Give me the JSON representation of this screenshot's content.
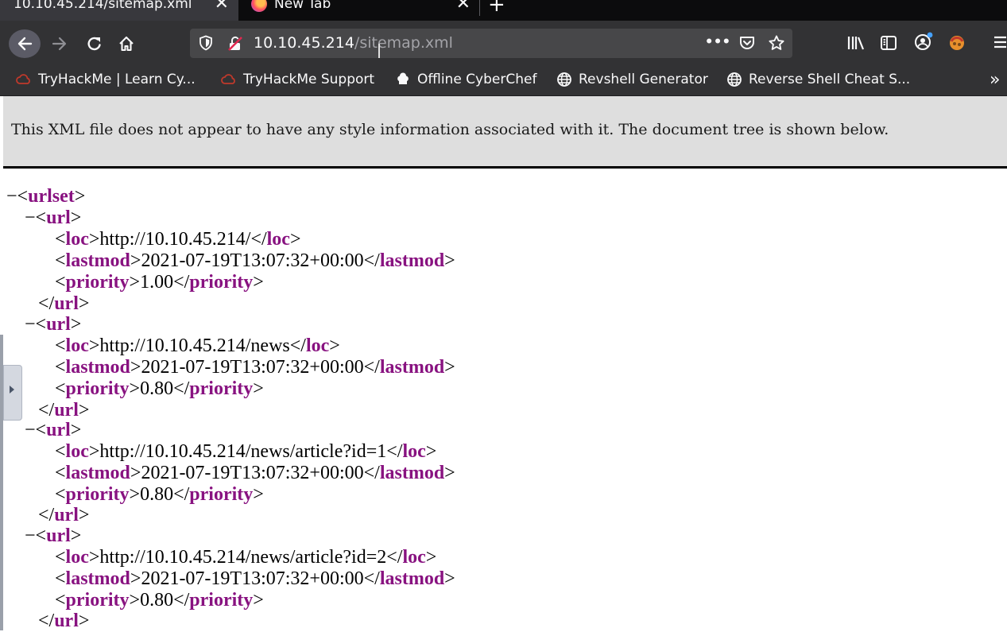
{
  "tabs": [
    {
      "title": "10.10.45.214/sitemap.xml",
      "close": "✕",
      "active": true
    },
    {
      "title": "New Tab",
      "close": "✕",
      "active": false,
      "icon": "firefox-icon"
    }
  ],
  "new_tab": "+",
  "nav": {
    "url_host": "10.10.45.214",
    "url_path": "/sitemap.xml",
    "page_actions": "•••"
  },
  "bookmarks": [
    {
      "label": "TryHackMe | Learn Cy...",
      "icon": "tryhackme-cloud-icon"
    },
    {
      "label": "TryHackMe Support",
      "icon": "tryhackme-cloud-icon"
    },
    {
      "label": "Offline CyberChef",
      "icon": "chef-hat-icon"
    },
    {
      "label": "Revshell Generator",
      "icon": "globe-icon"
    },
    {
      "label": "Reverse Shell Cheat S...",
      "icon": "globe-icon"
    }
  ],
  "bookmarks_overflow": "»",
  "xml_notice": "This XML file does not appear to have any style information associated with it. The document tree is shown below.",
  "tree": {
    "fold_marker": "−",
    "root_tag": "urlset",
    "url_tag": "url",
    "loc_tag": "loc",
    "lastmod_tag": "lastmod",
    "priority_tag": "priority",
    "urls": [
      {
        "loc": "http://10.10.45.214/",
        "lastmod": "2021-07-19T13:07:32+00:00",
        "priority": "1.00"
      },
      {
        "loc": "http://10.10.45.214/news",
        "lastmod": "2021-07-19T13:07:32+00:00",
        "priority": "0.80"
      },
      {
        "loc": "http://10.10.45.214/news/article?id=1",
        "lastmod": "2021-07-19T13:07:32+00:00",
        "priority": "0.80"
      },
      {
        "loc": "http://10.10.45.214/news/article?id=2",
        "lastmod": "2021-07-19T13:07:32+00:00",
        "priority": "0.80"
      }
    ]
  },
  "colors": {
    "tag": "#881280",
    "chrome_dark": "#0c0c0d",
    "toolbar": "#323234",
    "notice_bg": "#dedede"
  }
}
